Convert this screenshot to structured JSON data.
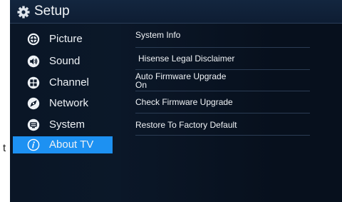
{
  "header": {
    "title": "Setup",
    "icon": "gear-icon"
  },
  "sidebar": {
    "items": [
      {
        "label": "Picture",
        "icon": "picture-icon"
      },
      {
        "label": "Sound",
        "icon": "sound-icon"
      },
      {
        "label": "Channel",
        "icon": "channel-icon"
      },
      {
        "label": "Network",
        "icon": "network-icon"
      },
      {
        "label": "System",
        "icon": "system-icon"
      },
      {
        "label": "About TV",
        "icon": "info-icon",
        "selected": true
      }
    ]
  },
  "content": {
    "options": [
      {
        "label": "System Info"
      },
      {
        "label": "Hisense Legal Disclaimer"
      },
      {
        "label": "Auto Firmware Upgrade",
        "value": "On"
      },
      {
        "label": "Check Firmware Upgrade"
      },
      {
        "label": "Restore To Factory Default"
      }
    ]
  },
  "outside_text": "t",
  "colors": {
    "selected": "#1d91f2",
    "background": "#07101d",
    "header": "#13263f"
  }
}
